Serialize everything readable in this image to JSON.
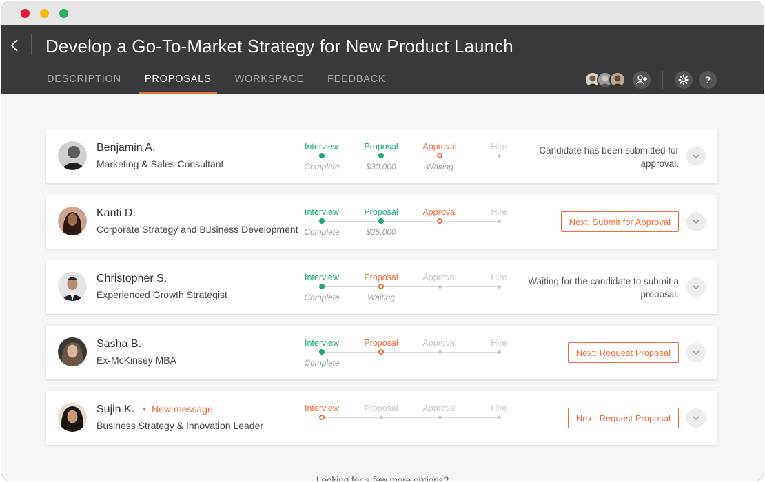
{
  "window": {
    "traffic_lights": [
      "red",
      "yellow",
      "green"
    ]
  },
  "header": {
    "title": "Develop a Go-To-Market Strategy for New Product Launch",
    "back_icon": "chevron-left-icon",
    "tabs": [
      {
        "label": "DESCRIPTION",
        "active": false
      },
      {
        "label": "PROPOSALS",
        "active": true
      },
      {
        "label": "WORKSPACE",
        "active": false
      },
      {
        "label": "FEEDBACK",
        "active": false
      }
    ],
    "team_avatars": 3,
    "icons": [
      "add-user-icon",
      "gear-icon",
      "help-icon"
    ],
    "help_label": "?"
  },
  "stage_names": [
    "Interview",
    "Proposal",
    "Approval",
    "Hire"
  ],
  "candidates": [
    {
      "name": "Benjamin A.",
      "role": "Marketing & Sales Consultant",
      "new_message": "",
      "stages": [
        {
          "label": "Interview",
          "state": "done",
          "sub": "Complete"
        },
        {
          "label": "Proposal",
          "state": "done",
          "sub": "$30,000"
        },
        {
          "label": "Approval",
          "state": "current",
          "sub": "Waiting"
        },
        {
          "label": "Hire",
          "state": "pending",
          "sub": ""
        }
      ],
      "status_text": "Candidate has been submitted for approval.",
      "action": ""
    },
    {
      "name": "Kanti D.",
      "role": "Corporate Strategy and Business Development",
      "new_message": "",
      "stages": [
        {
          "label": "Interview",
          "state": "done",
          "sub": "Complete"
        },
        {
          "label": "Proposal",
          "state": "done",
          "sub": "$25,000"
        },
        {
          "label": "Approval",
          "state": "current",
          "sub": ""
        },
        {
          "label": "Hire",
          "state": "pending",
          "sub": ""
        }
      ],
      "status_text": "",
      "action": "Next: Submit for Approval"
    },
    {
      "name": "Christopher S.",
      "role": "Experienced Growth Strategist",
      "new_message": "",
      "stages": [
        {
          "label": "Interview",
          "state": "done",
          "sub": "Complete"
        },
        {
          "label": "Proposal",
          "state": "current",
          "sub": "Waiting"
        },
        {
          "label": "Approval",
          "state": "pending",
          "sub": ""
        },
        {
          "label": "Hire",
          "state": "pending",
          "sub": ""
        }
      ],
      "status_text": "Waiting for the candidate to submit a proposal.",
      "action": ""
    },
    {
      "name": "Sasha B.",
      "role": "Ex-McKinsey MBA",
      "new_message": "",
      "stages": [
        {
          "label": "Interview",
          "state": "done",
          "sub": "Complete"
        },
        {
          "label": "Proposal",
          "state": "current",
          "sub": ""
        },
        {
          "label": "Approval",
          "state": "pending",
          "sub": ""
        },
        {
          "label": "Hire",
          "state": "pending",
          "sub": ""
        }
      ],
      "status_text": "",
      "action": "Next: Request Proposal"
    },
    {
      "name": "Sujin K.",
      "role": "Business Strategy & Innovation Leader",
      "new_message": "New message",
      "stages": [
        {
          "label": "Interview",
          "state": "current",
          "sub": ""
        },
        {
          "label": "Proposal",
          "state": "pending",
          "sub": ""
        },
        {
          "label": "Approval",
          "state": "pending",
          "sub": ""
        },
        {
          "label": "Hire",
          "state": "pending",
          "sub": ""
        }
      ],
      "status_text": "",
      "action": "Next: Request Proposal"
    }
  ],
  "footer_hint": "Looking for a few more options?",
  "colors": {
    "header_bg": "#3a3a3a",
    "accent_orange": "#f26b3a",
    "done_green": "#16a77c",
    "pending_gray": "#c4c4c4",
    "page_bg": "#f5f5f5"
  }
}
